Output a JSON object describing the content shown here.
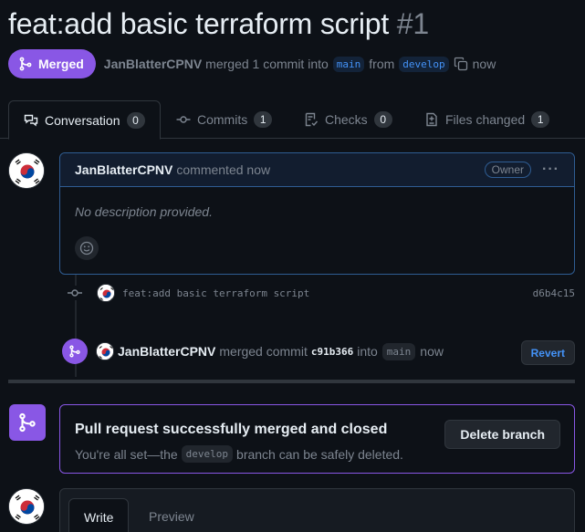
{
  "pr": {
    "title": "feat:add basic terraform script",
    "number": "#1",
    "state": "Merged",
    "author": "JanBlatterCPNV",
    "merge_summary": "merged 1 commit into",
    "base_branch": "main",
    "from_word": "from",
    "head_branch": "develop",
    "time": "now"
  },
  "tabs": [
    {
      "label": "Conversation",
      "count": "0"
    },
    {
      "label": "Commits",
      "count": "1"
    },
    {
      "label": "Checks",
      "count": "0"
    },
    {
      "label": "Files changed",
      "count": "1"
    }
  ],
  "comment": {
    "author": "JanBlatterCPNV",
    "action": "commented now",
    "role": "Owner",
    "menu": "···",
    "body": "No description provided."
  },
  "commit": {
    "message": "feat:add basic terraform script",
    "sha": "d6b4c15"
  },
  "merge_event": {
    "author": "JanBlatterCPNV",
    "text": "merged commit",
    "sha": "c91b366",
    "into": "into",
    "branch": "main",
    "time": "now",
    "revert_label": "Revert"
  },
  "merged_box": {
    "title": "Pull request successfully merged and closed",
    "desc_before": "You're all set—the",
    "branch": "develop",
    "desc_after": "branch can be safely deleted.",
    "delete_label": "Delete branch"
  },
  "editor": {
    "write_label": "Write",
    "preview_label": "Preview"
  },
  "colors": {
    "merged_purple": "#8957e5",
    "link_blue": "#4493f8",
    "bg": "#0d1117"
  }
}
